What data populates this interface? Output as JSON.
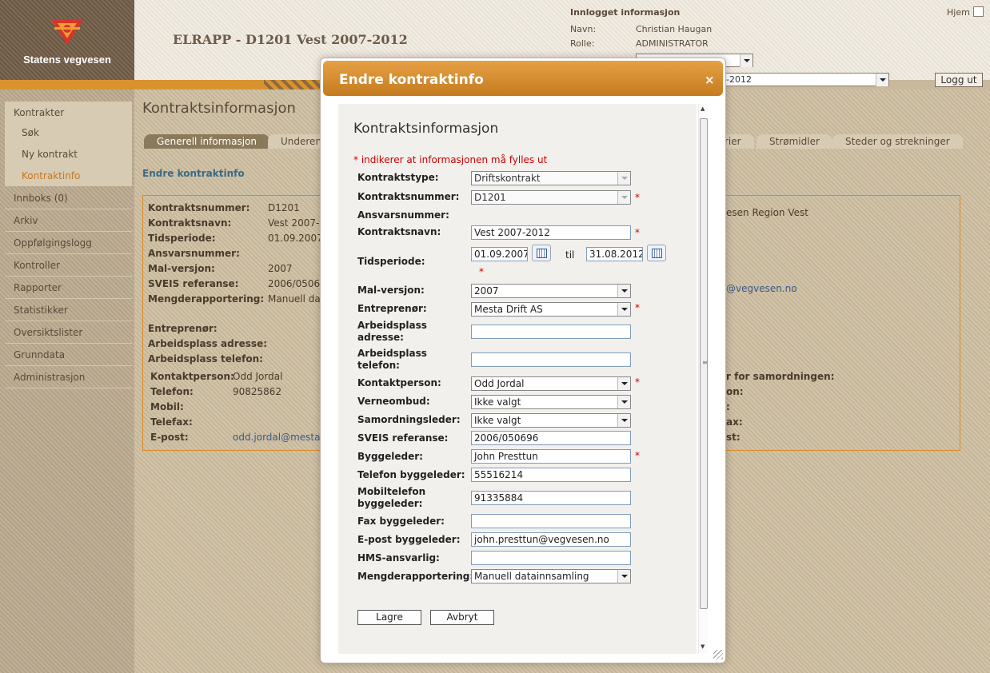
{
  "header": {
    "logo_text": "Statens vegvesen",
    "app_title": "ELRAPP - D1201 Vest 2007-2012",
    "login_title": "Innlogget informasjon",
    "name_label": "Navn:",
    "name_value": "Christian Haugan",
    "role_label": "Rolle:",
    "role_value": "ADMINISTRATOR",
    "home_link": "Hjem",
    "contract_select_value": "-2012",
    "logout_button": "Logg ut"
  },
  "sidebar": {
    "items": [
      {
        "label": "Kontrakter"
      },
      {
        "label": "Søk"
      },
      {
        "label": "Ny kontrakt"
      },
      {
        "label": "Kontraktinfo"
      },
      {
        "label": "Innboks (0)"
      },
      {
        "label": "Arkiv"
      },
      {
        "label": "Oppfølgingslogg"
      },
      {
        "label": "Kontroller"
      },
      {
        "label": "Rapporter"
      },
      {
        "label": "Statistikker"
      },
      {
        "label": "Oversiktslister"
      },
      {
        "label": "Grunndata"
      },
      {
        "label": "Administrasjon"
      }
    ]
  },
  "main": {
    "title": "Kontraktsinformasjon",
    "tabs": [
      "Generell informasjon",
      "Underen",
      "rier",
      "Strømidler",
      "Steder og strekninger"
    ],
    "edit_link": "Endre kontraktinfo",
    "info": {
      "l1": "Kontraktsnummer:",
      "v1": "D1201",
      "l2": "Kontraktsnavn:",
      "v2": "Vest 2007-",
      "l3": "Tidsperiode:",
      "v3": "01.09.2007",
      "l4": "Ansvarsnummer:",
      "l5": "Mal-versjon:",
      "v5": "2007",
      "l6": "SVEIS referanse:",
      "v6": "2006/05069",
      "l7": "Mengderapportering:",
      "v7": "Manuell dat",
      "l8": "Entreprenør:",
      "l9": "Arbeidsplass adresse:",
      "l10": "Arbeidsplass telefon:",
      "l11": "Kontaktperson:",
      "v11": "Odd Jordal",
      "l12": "Telefon:",
      "v12": "90825862",
      "l13": "Mobil:",
      "l14": "Telefax:",
      "l15": "E-post:",
      "v15": "odd.jordal@mesta.",
      "r1": "esen Region Vest",
      "r2": "@vegvesen.no",
      "r3": "r for samordningen:",
      "r4": "on:",
      "r5": ":",
      "r6": "ax:",
      "r7": "st:"
    }
  },
  "dialog": {
    "title": "Endre kontraktinfo",
    "close": "×",
    "form_title": "Kontraktsinformasjon",
    "required_note": "* indikerer at informasjonen må fylles ut",
    "required_marker": "*",
    "labels": {
      "kontraktstype": "Kontraktstype:",
      "kontraktsnummer": "Kontraktsnummer:",
      "ansvarsnummer": "Ansvarsnummer:",
      "kontraktsnavn": "Kontraktsnavn:",
      "tidsperiode": "Tidsperiode:",
      "til": "til",
      "mal_versjon": "Mal-versjon:",
      "entreprenor": "Entreprenør:",
      "arbeidsplass_adresse_1": "Arbeidsplass",
      "arbeidsplass_adresse_2": "adresse:",
      "arbeidsplass_telefon_1": "Arbeidsplass",
      "arbeidsplass_telefon_2": "telefon:",
      "kontaktperson": "Kontaktperson:",
      "verneombud": "Verneombud:",
      "samordningsleder": "Samordningsleder:",
      "sveis": "SVEIS referanse:",
      "byggeleder": "Byggeleder:",
      "telefon_byggeleder": "Telefon byggeleder:",
      "mobil_byggeleder_1": "Mobiltelefon",
      "mobil_byggeleder_2": "byggeleder:",
      "fax_byggeleder": "Fax byggeleder:",
      "epost_byggeleder": "E-post byggeleder:",
      "hms": "HMS-ansvarlig:",
      "mengderapportering": "Mengderapportering:"
    },
    "values": {
      "kontraktstype": "Driftskontrakt",
      "kontraktsnummer": "D1201",
      "kontraktsnavn": "Vest 2007-2012",
      "fra_dato": "01.09.2007",
      "til_dato": "31.08.2012",
      "mal_versjon": "2007",
      "entreprenor": "Mesta Drift AS",
      "arbeidsplass_adresse": "",
      "arbeidsplass_telefon": "",
      "kontaktperson": "Odd Jordal",
      "verneombud": "Ikke valgt",
      "samordningsleder": "Ikke valgt",
      "sveis": "2006/050696",
      "byggeleder": "John Presttun",
      "telefon_byggeleder": "55516214",
      "mobil_byggeleder": "91335884",
      "fax_byggeleder": "",
      "epost_byggeleder": "john.presttun@vegvesen.no",
      "hms": "",
      "mengderapportering": "Manuell datainnsamling"
    },
    "save_button": "Lagre",
    "cancel_button": "Avbryt"
  },
  "colors": {
    "accent_orange": "#d9932e",
    "required_red": "#cc0000",
    "header_brown": "#6e5a44"
  }
}
